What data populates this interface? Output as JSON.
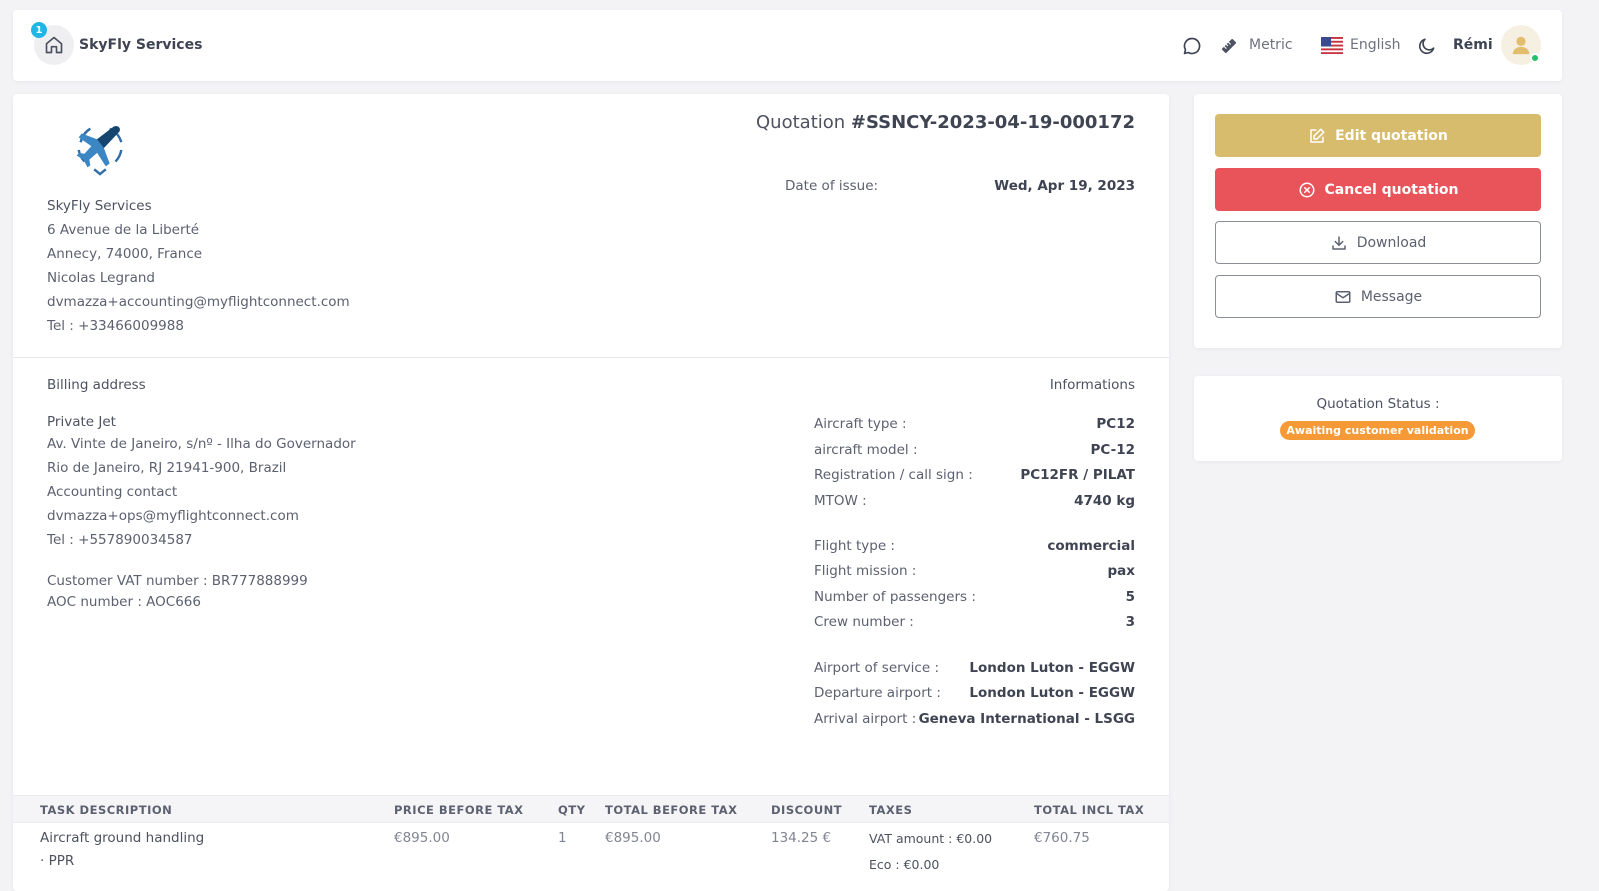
{
  "header": {
    "notification_count": "1",
    "brand": "SkyFly Services",
    "units": "Metric",
    "language": "English",
    "user": "Rémi"
  },
  "company": {
    "lines": [
      "SkyFly Services",
      "6 Avenue de la Liberté",
      "Annecy,  74000,  France",
      "Nicolas Legrand",
      "dvmazza+accounting@myflightconnect.com",
      "Tel : +33466009988"
    ]
  },
  "quotation": {
    "title_prefix": "Quotation",
    "number": "#SSNCY-2023-04-19-000172",
    "date_label": "Date of issue:",
    "date_value": "Wed, Apr 19, 2023"
  },
  "billing": {
    "heading": "Billing address",
    "lines": [
      "Private Jet",
      "Av. Vinte de Janeiro, s/nº - Ilha do Governador",
      "Rio de Janeiro,  RJ 21941-900,  Brazil",
      "Accounting contact",
      "dvmazza+ops@myflightconnect.com",
      "Tel : +557890034587"
    ],
    "vat": "Customer VAT number : BR777888999",
    "aoc": "AOC number : AOC666"
  },
  "informations": {
    "heading": "Informations",
    "rows": [
      {
        "label": "Aircraft type :",
        "value": "PC12"
      },
      {
        "label": "aircraft model :",
        "value": "PC-12"
      },
      {
        "label": "Registration / call sign :",
        "value": "PC12FR / PILAT"
      },
      {
        "label": "MTOW :",
        "value": "4740 kg"
      },
      {
        "label": "Flight type :",
        "value": "commercial"
      },
      {
        "label": "Flight mission :",
        "value": "pax"
      },
      {
        "label": "Number of passengers :",
        "value": "5"
      },
      {
        "label": "Crew number :",
        "value": "3"
      },
      {
        "label": "Airport of service :",
        "value": "London Luton - EGGW"
      },
      {
        "label": "Departure airport :",
        "value": "London Luton - EGGW"
      },
      {
        "label": "Arrival airport :",
        "value": "Geneva International - LSGG"
      }
    ]
  },
  "table": {
    "headers": [
      "TASK DESCRIPTION",
      "PRICE BEFORE TAX",
      "QTY",
      "TOTAL BEFORE TAX",
      "DISCOUNT",
      "TAXES",
      "TOTAL INCL TAX"
    ],
    "rows": [
      {
        "task": "Aircraft ground handling",
        "sub": "· PPR",
        "price": "€895.00",
        "qty": "1",
        "total_before": "€895.00",
        "discount": "134.25 €",
        "vat": "VAT amount : €0.00",
        "eco": "Eco : €0.00",
        "total_incl": "€760.75"
      }
    ]
  },
  "actions": {
    "edit": "Edit quotation",
    "cancel": "Cancel quotation",
    "download": "Download",
    "message": "Message"
  },
  "status": {
    "title": "Quotation Status :",
    "badge": "Awaiting customer validation",
    "badge_color": "#f59a36"
  },
  "colors": {
    "edit_button": "#d8bc6d",
    "cancel_button": "#e9535a",
    "notification_badge": "#1fb6e6",
    "online_dot": "#24c16b"
  }
}
